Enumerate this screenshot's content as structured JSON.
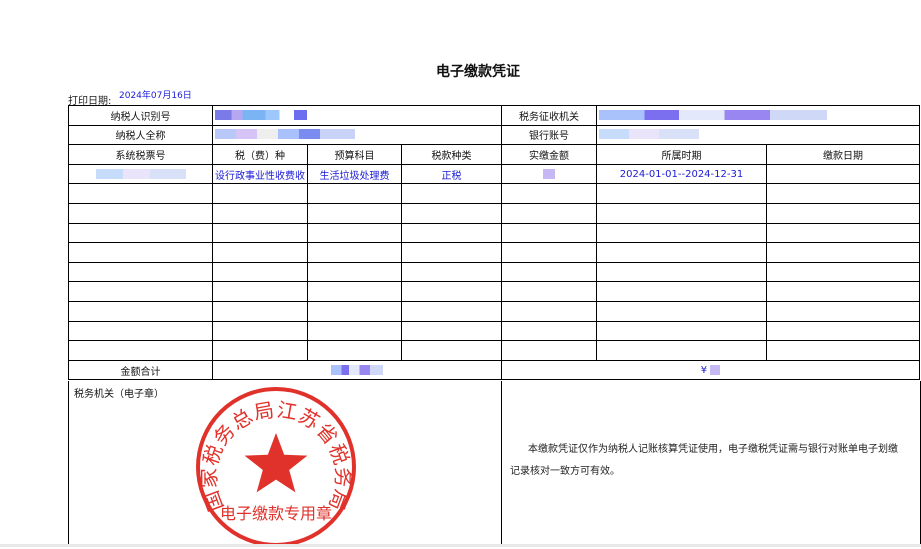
{
  "document": {
    "title": "电子缴款凭证",
    "print_date_label": "打印日期:",
    "print_date_value": "2024年07月16日"
  },
  "info_rows": {
    "taxpayer_id_label": "纳税人识别号",
    "tax_authority_label": "税务征收机关",
    "taxpayer_name_label": "纳税人全称",
    "bank_account_label": "银行账号"
  },
  "table": {
    "headers": [
      "系统税票号",
      "税（费）种",
      "预算科目",
      "税款种类",
      "实缴金额",
      "所属时期",
      "缴款日期"
    ],
    "rows": [
      {
        "tax_type": "设行政事业性收费收",
        "budget_subject": "生活垃圾处理费",
        "tax_kind": "正税",
        "period": "2024-01-01--2024-12-31"
      }
    ],
    "total_label": "金额合计",
    "total_currency_symbol": "¥"
  },
  "bottom": {
    "tax_office_seal_label": "税务机关（电子章）",
    "notice_text": "本缴款凭证仅作为纳税人记账核算凭证使用，电子缴税凭证需与银行对账单电子划缴记录核对一致方可有效。"
  },
  "seal": {
    "outer_text": "国家税务总局江苏省税务局",
    "inner_text": "电子缴款专用章",
    "color": "#e0322b"
  }
}
